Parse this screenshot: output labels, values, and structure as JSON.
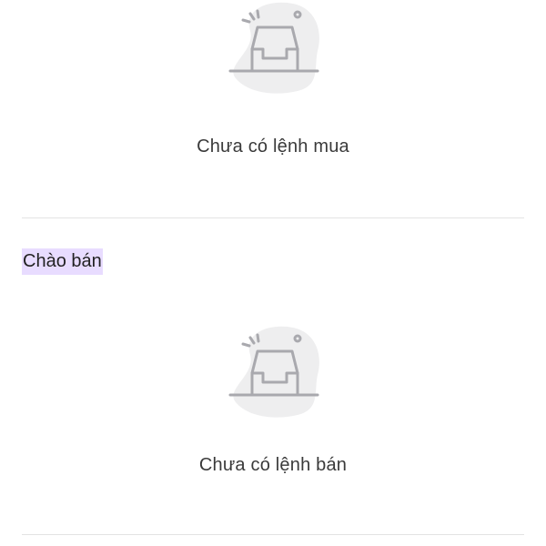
{
  "buy_section": {
    "empty_icon": "empty-inbox-icon",
    "empty_text": "Chưa có lệnh mua"
  },
  "sell_section": {
    "title": "Chào bán",
    "title_highlight_color": "#e8dcff",
    "empty_icon": "empty-inbox-icon",
    "empty_text": "Chưa có lệnh bán"
  },
  "colors": {
    "icon_blob": "#eeeeef",
    "icon_stroke": "#a9a9ae",
    "divider": "#e3e3e3",
    "text": "#3a3a3a"
  }
}
